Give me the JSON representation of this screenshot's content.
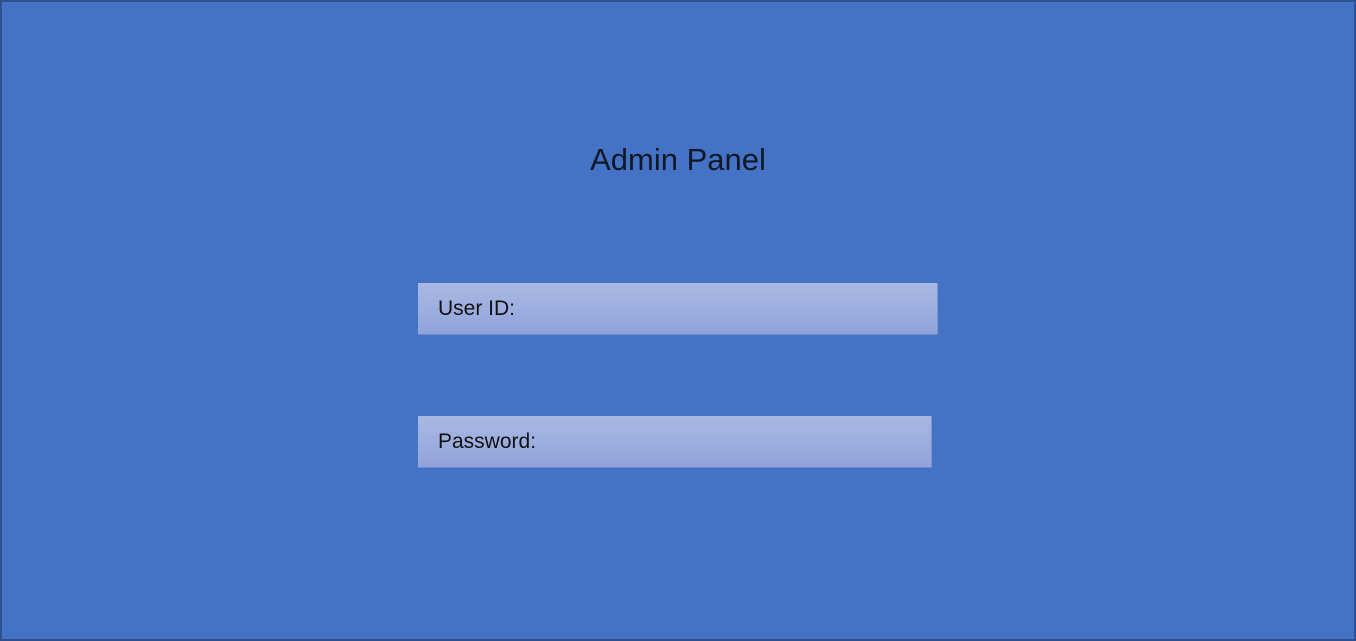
{
  "app": {
    "title": "Admin Panel"
  },
  "login_form": {
    "user_id_label": "User ID:",
    "password_label": "Password:"
  },
  "colors": {
    "background": "#4472c4",
    "border": "#2f528f",
    "field_fill": "#9caedf"
  }
}
